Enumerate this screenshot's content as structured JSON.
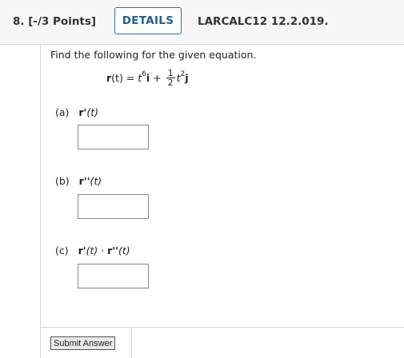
{
  "header": {
    "question_number": "8.  [-/3 Points]",
    "details_label": "DETAILS",
    "reference": "LARCALC12 12.2.019."
  },
  "problem": {
    "prompt": "Find the following for the given equation.",
    "equation": {
      "lhs": "r",
      "lhs_arg": "(t)",
      "equals": " = ",
      "term1_var": "t",
      "term1_exp": "6",
      "term1_unit": "i",
      "plus": " + ",
      "frac_num": "1",
      "frac_den": "2",
      "term2_var": "t",
      "term2_exp": "2",
      "term2_unit": "j"
    }
  },
  "parts": [
    {
      "letter": "(a)",
      "expr_bold": "r'",
      "expr_arg": "(t)"
    },
    {
      "letter": "(b)",
      "expr_bold": "r''",
      "expr_arg": "(t)"
    },
    {
      "letter": "(c)",
      "expr_bold": "r'",
      "expr_arg": "(t)",
      "dot": " · ",
      "expr2_bold": "r''",
      "expr2_arg": "(t)"
    }
  ],
  "answers": [
    "",
    "",
    ""
  ],
  "submit_label": "Submit Answer"
}
